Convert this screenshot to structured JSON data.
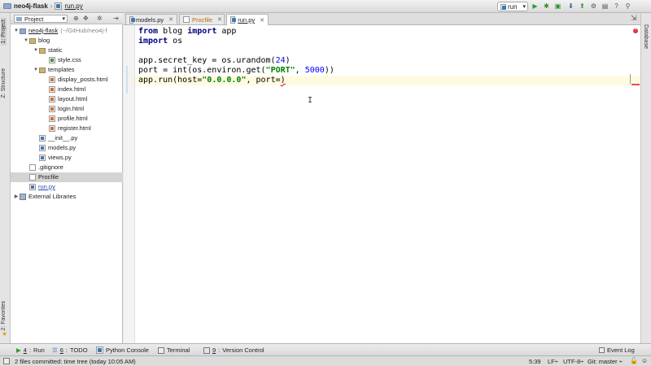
{
  "titlebar": {
    "breadcrumb_project": "neo4j-flask",
    "breadcrumb_file": "run.py",
    "run_config": "run"
  },
  "left_strip": {
    "project_label": "1: Project",
    "structure_label": "Z: Structure",
    "favorites_label": "2: Favorites"
  },
  "right_strip": {
    "database_label": "Database"
  },
  "project_panel": {
    "selector_label": "Project",
    "tree": [
      {
        "label": "neo4j-flask",
        "suffix": "(~/GitHub/neo4j-f",
        "depth": 0,
        "arrow": "▼",
        "icon": "folder-blue"
      },
      {
        "label": "blog",
        "depth": 1,
        "arrow": "▼",
        "icon": "folder"
      },
      {
        "label": "static",
        "depth": 2,
        "arrow": "▼",
        "icon": "folder"
      },
      {
        "label": "style.css",
        "depth": 3,
        "arrow": "",
        "icon": "css"
      },
      {
        "label": "templates",
        "depth": 2,
        "arrow": "▼",
        "icon": "folder"
      },
      {
        "label": "display_posts.html",
        "depth": 3,
        "arrow": "",
        "icon": "html"
      },
      {
        "label": "index.html",
        "depth": 3,
        "arrow": "",
        "icon": "html"
      },
      {
        "label": "layout.html",
        "depth": 3,
        "arrow": "",
        "icon": "html"
      },
      {
        "label": "login.html",
        "depth": 3,
        "arrow": "",
        "icon": "html"
      },
      {
        "label": "profile.html",
        "depth": 3,
        "arrow": "",
        "icon": "html"
      },
      {
        "label": "register.html",
        "depth": 3,
        "arrow": "",
        "icon": "html"
      },
      {
        "label": "__init__.py",
        "depth": 2,
        "arrow": "",
        "icon": "py"
      },
      {
        "label": "models.py",
        "depth": 2,
        "arrow": "",
        "icon": "py"
      },
      {
        "label": "views.py",
        "depth": 2,
        "arrow": "",
        "icon": "py"
      },
      {
        "label": ".gitignore",
        "depth": 1,
        "arrow": "",
        "icon": "text"
      },
      {
        "label": "Procfile",
        "depth": 1,
        "arrow": "",
        "icon": "text",
        "selected": true
      },
      {
        "label": "run.py",
        "depth": 1,
        "arrow": "",
        "icon": "py",
        "link": true
      },
      {
        "label": "External Libraries",
        "depth": 0,
        "arrow": "▶",
        "icon": "lib"
      }
    ]
  },
  "tabs": [
    {
      "label": "models.py",
      "style": "normal"
    },
    {
      "label": "Procfile",
      "style": "orange"
    },
    {
      "label": "run.py",
      "style": "active"
    }
  ],
  "editor": {
    "lines": [
      {
        "tokens": [
          {
            "t": "from",
            "c": "kw"
          },
          {
            "t": " blog ",
            "c": ""
          },
          {
            "t": "import",
            "c": "kw"
          },
          {
            "t": " app",
            "c": ""
          }
        ]
      },
      {
        "tokens": [
          {
            "t": "import",
            "c": "kw"
          },
          {
            "t": " os",
            "c": ""
          }
        ]
      },
      {
        "tokens": []
      },
      {
        "tokens": [
          {
            "t": "app.secret_key = os.urandom(",
            "c": ""
          },
          {
            "t": "24",
            "c": "num"
          },
          {
            "t": ")",
            "c": ""
          }
        ]
      },
      {
        "tokens": [
          {
            "t": "port = int(os.environ.get(",
            "c": ""
          },
          {
            "t": "\"PORT\"",
            "c": "str"
          },
          {
            "t": ", ",
            "c": ""
          },
          {
            "t": "5000",
            "c": "num"
          },
          {
            "t": "))",
            "c": ""
          }
        ]
      },
      {
        "tokens": [
          {
            "t": "app.run(host=",
            "c": ""
          },
          {
            "t": "\"0.0.0.0\"",
            "c": "str"
          },
          {
            "t": ", port=",
            "c": ""
          },
          {
            "t": ")",
            "c": "err"
          }
        ]
      }
    ]
  },
  "bottom_tools": [
    {
      "num": "4",
      "label": "Run"
    },
    {
      "num": "6",
      "label": "TODO"
    },
    {
      "num": "",
      "label": "Python Console"
    },
    {
      "num": "",
      "label": "Terminal"
    },
    {
      "num": "9",
      "label": "Version Control"
    }
  ],
  "event_log": "Event Log",
  "status": {
    "message": "2 files committed: time tree (today 10:05 AM)",
    "position": "5:39",
    "line_sep": "LF÷",
    "encoding": "UTF-8÷",
    "git": "Git: master ÷"
  },
  "colors": {
    "keyword": "#000080",
    "string": "#008000",
    "number": "#0000ff",
    "error": "#dd0000"
  }
}
